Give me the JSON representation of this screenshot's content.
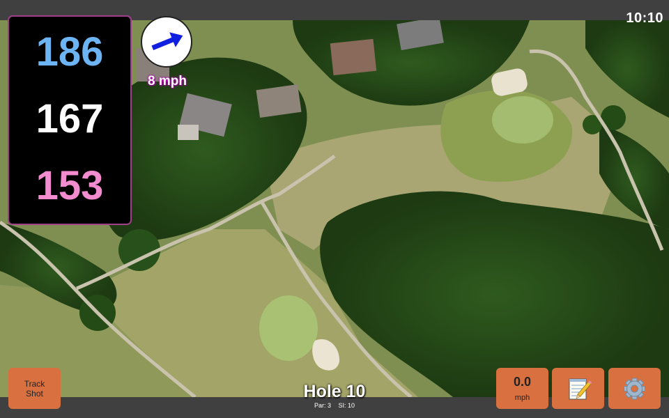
{
  "status_bar": {
    "time": "10:10"
  },
  "distances": {
    "back": "186",
    "center": "167",
    "front": "153",
    "colors": {
      "back": "#6cb4f4",
      "center": "#ffffff",
      "front": "#f28ccf",
      "panel_border": "#a0408a"
    }
  },
  "wind": {
    "speed_label": "8 mph",
    "icon": "wind-direction-arrow-icon",
    "arrow_color": "#1020e0"
  },
  "buttons": {
    "track_shot": {
      "line1": "Track",
      "line2": "Shot"
    },
    "speed": {
      "value": "0.0",
      "unit": "mph"
    },
    "notes": {
      "icon": "notepad-icon"
    },
    "settings": {
      "icon": "gear-icon"
    },
    "accent": "#d8713f"
  },
  "hole": {
    "title": "Hole 10",
    "par": "Par: 3",
    "si": "SI: 10"
  }
}
